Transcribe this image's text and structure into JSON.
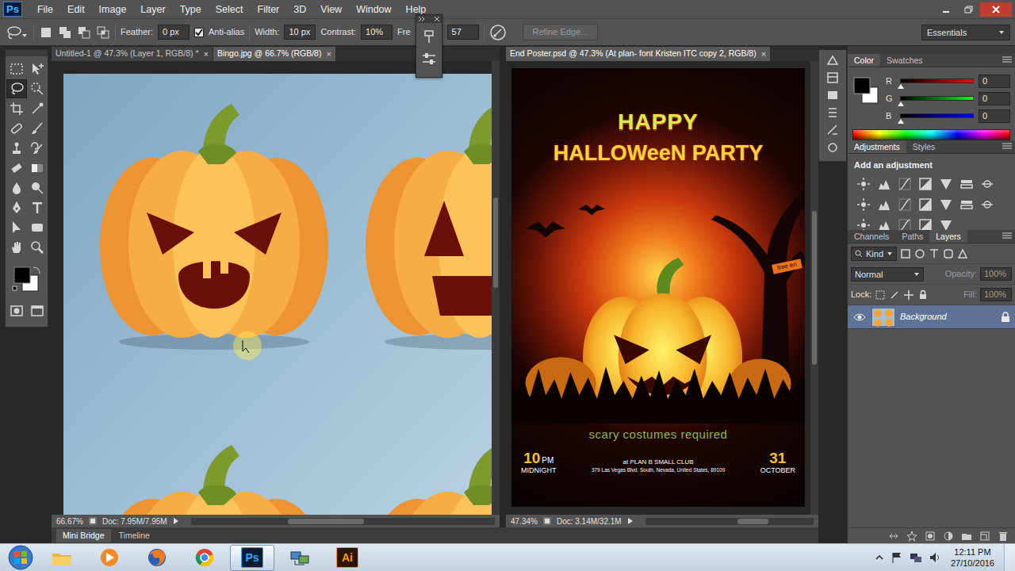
{
  "app": {
    "logo": "Ps"
  },
  "menu": [
    "File",
    "Edit",
    "Image",
    "Layer",
    "Type",
    "Select",
    "Filter",
    "3D",
    "View",
    "Window",
    "Help"
  ],
  "options": {
    "feather": {
      "label": "Feather:",
      "value": "0 px"
    },
    "antialias": {
      "label": "Anti-alias",
      "checked": true
    },
    "width": {
      "label": "Width:",
      "value": "10 px"
    },
    "contrast": {
      "label": "Contrast:",
      "value": "10%"
    },
    "frequency": {
      "label": "Fre",
      "value": "57"
    },
    "refine_edge": {
      "label": "Refine Edge...",
      "disabled": true
    },
    "workspace": "Essentials"
  },
  "tools": [
    {
      "kind": "marquee",
      "selected": false
    },
    {
      "kind": "move",
      "selected": false
    },
    {
      "kind": "lasso",
      "selected": true
    },
    {
      "kind": "quick-select",
      "selected": false
    },
    {
      "kind": "crop",
      "selected": false
    },
    {
      "kind": "eyedropper",
      "selected": false
    },
    {
      "kind": "healing",
      "selected": false
    },
    {
      "kind": "brush",
      "selected": false
    },
    {
      "kind": "clone",
      "selected": false
    },
    {
      "kind": "history-brush",
      "selected": false
    },
    {
      "kind": "eraser",
      "selected": false
    },
    {
      "kind": "gradient",
      "selected": false
    },
    {
      "kind": "blur",
      "selected": false
    },
    {
      "kind": "dodge",
      "selected": false
    },
    {
      "kind": "pen",
      "selected": false
    },
    {
      "kind": "type",
      "selected": false
    },
    {
      "kind": "path-select",
      "selected": false
    },
    {
      "kind": "shape",
      "selected": false
    },
    {
      "kind": "hand",
      "selected": false
    },
    {
      "kind": "zoom",
      "selected": false
    }
  ],
  "documents": [
    {
      "tabs": [
        {
          "label": "Untitled-1 @ 47.3% (Layer 1, RGB/8) *",
          "close": "×",
          "selected": false
        },
        {
          "label": "Bingo.jpg @ 66.7% (RGB/8)",
          "close": "×",
          "selected": true
        }
      ],
      "zoom": "66.67%",
      "doc": "Doc: 7.95M/7.95M"
    },
    {
      "tabs": [
        {
          "label": "End Poster.psd @ 47.3% (At plan- font Kristen ITC copy 2, RGB/8)",
          "close": "×",
          "selected": true
        }
      ],
      "zoom": "47.34%",
      "doc": "Doc: 3.14M/32.1M"
    }
  ],
  "poster": {
    "headline": "HAPPY",
    "title": "HALLOWeeN PARTY",
    "banner": "free en",
    "subtitle": "scary costumes required",
    "time": "10",
    "meridiem": "PM",
    "time_note": "MIDNIGHT",
    "venue": "at PLAN B SMALL CLUB",
    "address": "379 Las Vegas Blvd. South, Nevada, United States, 89109",
    "day": "31",
    "month": "OCTOBER"
  },
  "color_panel": {
    "tabs": [
      {
        "label": "Color",
        "selected": true
      },
      {
        "label": "Swatches",
        "selected": false
      }
    ],
    "channels": [
      {
        "name": "R",
        "value": "0",
        "level": 0,
        "color": "#ff0000"
      },
      {
        "name": "G",
        "value": "0",
        "level": 0,
        "color": "#00ff00"
      },
      {
        "name": "B",
        "value": "0",
        "level": 0,
        "color": "#0000ff"
      }
    ]
  },
  "adjustments_panel": {
    "tabs": [
      {
        "label": "Adjustments",
        "selected": true
      },
      {
        "label": "Styles",
        "selected": false
      }
    ],
    "heading": "Add an adjustment"
  },
  "layers_panel": {
    "tabs": [
      {
        "label": "Channels",
        "selected": false
      },
      {
        "label": "Paths",
        "selected": false
      },
      {
        "label": "Layers",
        "selected": true
      }
    ],
    "filter": "Kind",
    "blend_mode": "Normal",
    "opacity": {
      "label": "Opacity:",
      "value": "100%",
      "disabled": true
    },
    "lock_label": "Lock:",
    "fill": {
      "label": "Fill:",
      "value": "100%",
      "disabled": true
    },
    "layers": [
      {
        "name": "Background",
        "visible": true,
        "locked": true,
        "selected": true
      }
    ]
  },
  "bottom_tabs": [
    {
      "label": "Mini Bridge",
      "selected": true
    },
    {
      "label": "Timeline",
      "selected": false
    }
  ],
  "taskbar": {
    "apps": [
      {
        "kind": "explorer",
        "active": false
      },
      {
        "kind": "media",
        "active": false
      },
      {
        "kind": "firefox",
        "active": false
      },
      {
        "kind": "chrome",
        "active": false
      },
      {
        "kind": "photoshop",
        "label": "Ps",
        "active": true
      },
      {
        "kind": "network",
        "active": false
      },
      {
        "kind": "illustrator",
        "label": "Ai",
        "active": false
      }
    ],
    "time": "12:11 PM",
    "date": "27/10/2016"
  }
}
